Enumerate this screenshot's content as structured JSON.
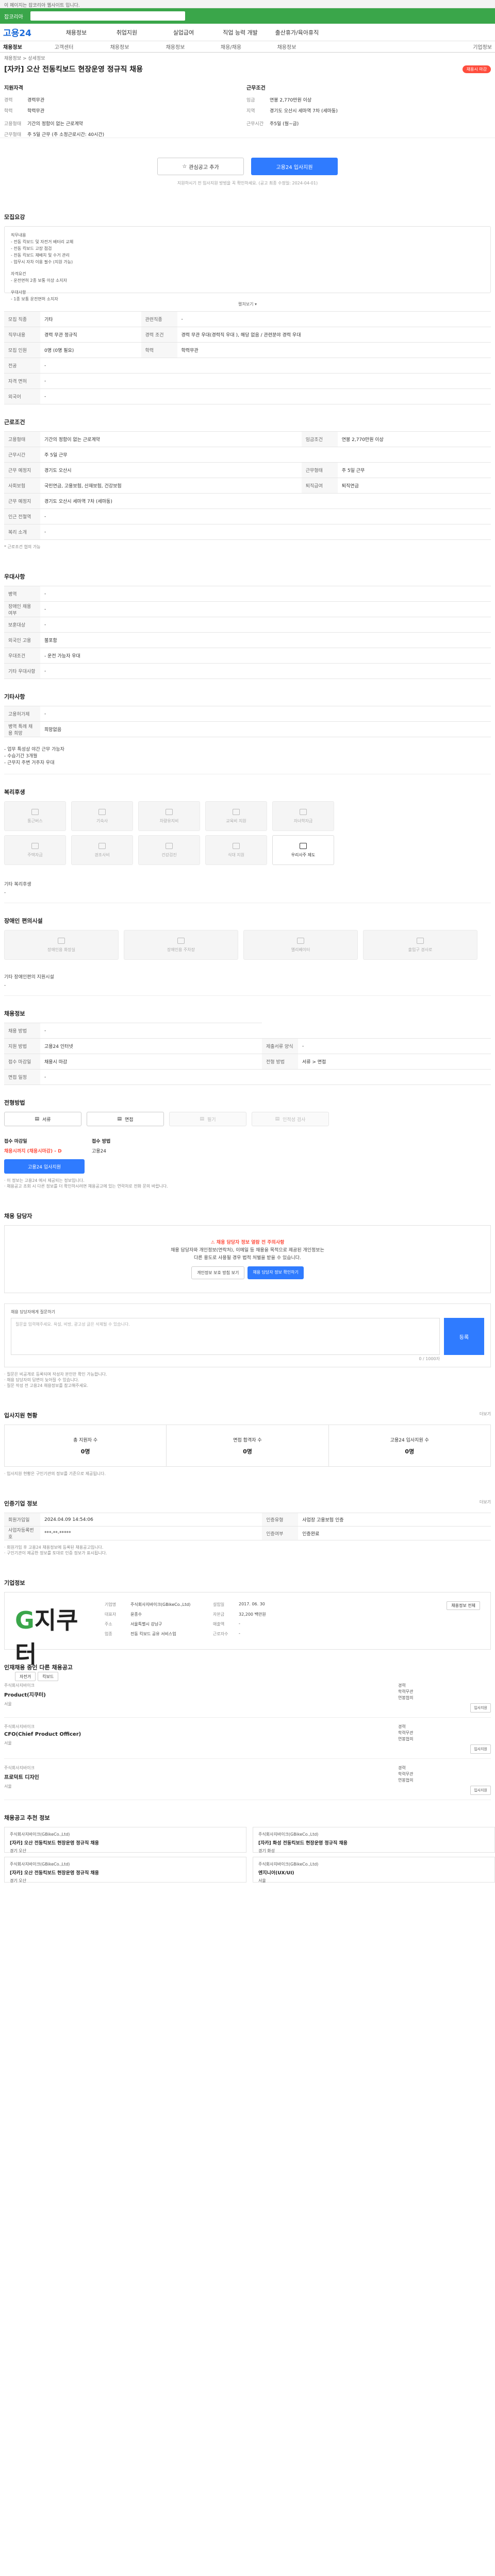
{
  "topnote": "이 페이지는 잡코리아 웹사이트 입니다.",
  "global_bar": {
    "title": "잡코리아"
  },
  "gnb": {
    "logo": "고용24",
    "menu": [
      "채용정보",
      "취업지원",
      "실업급여",
      "직업 능력 개발",
      "출산휴가/육아휴직"
    ]
  },
  "tabs": [
    "채용정보",
    "고객센터",
    "채용정보",
    "채용정보",
    "채용/채용",
    "채용정보",
    "기업정보"
  ],
  "breadcrumb": "채용정보 > 상세정보",
  "job": {
    "title": "[자카] 오산 전동킥보드 현장운영 정규직 채용",
    "badge": "채용시 마감",
    "left_head": "지원자격",
    "left": [
      {
        "k": "경력",
        "v": "경력무관"
      },
      {
        "k": "학력",
        "v": "학력무관"
      }
    ],
    "right_head": "근무조건",
    "right": [
      {
        "k": "임금",
        "v": "연봉 2,770만원 이상"
      },
      {
        "k": "지역",
        "v": "경기도 오산시 세마역 7차 (세마동)"
      }
    ],
    "extra": [
      {
        "k": "고용형태",
        "v": "기간의 정함이 없는 근로계약"
      },
      {
        "k": "근무형태",
        "v": "주 5일 근무 (주 소정근로시간: 40시간)"
      }
    ],
    "extra2": {
      "k": "근무시간",
      "v": "주5일 (월~금)"
    }
  },
  "buttons": {
    "interest": "관심공고 추가",
    "apply": "고용24 입사지원"
  },
  "apply_note": "지원하시기 전 입사지원 방법을 꼭 확인하세요. (공고 최종 수정일: 2024-04-01)",
  "sections": {
    "detail": "모집요강",
    "condition": "근로조건",
    "prefer": "우대사항",
    "other": "기타사항",
    "benefit": "복리후생",
    "facility": "장애인 편의시설",
    "info": "채용정보",
    "method": "전형방법",
    "qna": "채용 담당자",
    "status": "입사지원 현황",
    "company": "인증기업 정보",
    "company_info": "기업정보",
    "other_jobs": "인재채용 중인 다른 채용공고",
    "recommend": "채용공고 추천 정보"
  },
  "detail_text": [
    "직무내용",
    "- 전동 킥보드 및 자전거 배터리 교체",
    "- 전동 킥보드 고장 점검",
    "- 전동 킥보드 재배치 및 수거 관리",
    "- 업무시 자차 이용 필수 (지원 가능)",
    "",
    "자격요건",
    "- 운전면허 2종 보통 이상 소지자",
    "",
    "우대사항",
    "- 1종 보통 운전면허 소지자"
  ],
  "more": "펼쳐보기 ▾",
  "grid1": [
    {
      "k": "모집 직종",
      "v": "기타",
      "k2": "관련직종",
      "v2": "-"
    },
    {
      "k": "직무내용",
      "v": "경력 무관 정규직",
      "k2": "경력 조건",
      "v2": "경력 무관 우대(경력직 우대 ), 해당 없음 / 관련분야 경력 우대"
    },
    {
      "k": "모집 인원",
      "v": "0명 (0명 필요)",
      "k2": "학력",
      "v2": "학력무관"
    },
    {
      "k": "전공",
      "v": "-",
      "k2": "",
      "v2": ""
    },
    {
      "k": "자격 면허",
      "v": "-",
      "k2": "",
      "v2": ""
    },
    {
      "k": "외국어",
      "v": "-",
      "k2": "",
      "v2": ""
    }
  ],
  "grid2": [
    {
      "k": "고용형태",
      "v": "기간의 정함이 없는 근로계약",
      "k2": "임금조건",
      "v2": "연봉 2,770만원 이상"
    },
    {
      "k": "근무시간",
      "v": "주 5일 근무",
      "k2": "",
      "v2": ""
    },
    {
      "k": "근무 예정지",
      "v": "경기도 오산시",
      "k2": "근무형태",
      "v2": "주 5일 근무"
    },
    {
      "k": "사회보험",
      "v": "국민연금, 고용보험, 산재보험, 건강보험",
      "k2": "퇴직급여",
      "v2": "퇴직연금"
    },
    {
      "k": "근무 예정지",
      "v": "경기도 오산시 세마역 7차 (세마동)",
      "k2": "",
      "v2": ""
    },
    {
      "k": "인근 전철역",
      "v": "-",
      "k2": "",
      "v2": ""
    },
    {
      "k": "복리 소개",
      "v": "-",
      "k2": "",
      "v2": ""
    }
  ],
  "grid2_note": "* 근로조건 협의 가능",
  "grid3": [
    {
      "k": "병역",
      "v": "-"
    },
    {
      "k": "장애인 채용 여부",
      "v": "-"
    },
    {
      "k": "보훈대상",
      "v": "-"
    },
    {
      "k": "외국인 고용",
      "v": "불포함"
    },
    {
      "k": "우대조건",
      "v": "- 운전 가능자 우대"
    },
    {
      "k": "기타 우대사항",
      "v": "-"
    }
  ],
  "grid4": [
    {
      "k": "고용허가제",
      "v": "-"
    },
    {
      "k": "병역 특례 채용 희망",
      "v": "희망없음"
    }
  ],
  "other_list": [
    "- 업무 특성상 야간 근무 가능자",
    "- 수습기간 3개월",
    "- 근무지 주변 거주자 우대"
  ],
  "benefits": [
    {
      "label": "통근버스",
      "on": false
    },
    {
      "label": "기숙사",
      "on": false
    },
    {
      "label": "차량유지비",
      "on": false
    },
    {
      "label": "교육비 지원",
      "on": false
    },
    {
      "label": "자녀학자금",
      "on": false
    },
    {
      "label": "주택자금",
      "on": false
    },
    {
      "label": "경조사비",
      "on": false
    },
    {
      "label": "건강검진",
      "on": false
    },
    {
      "label": "식대 지원",
      "on": false
    },
    {
      "label": "우리사주 제도",
      "on": true
    }
  ],
  "benefit_other_label": "기타 복리후생",
  "benefit_other_value": "-",
  "facilities": [
    {
      "label": "장애인용 화장실"
    },
    {
      "label": "장애인용 주차장"
    },
    {
      "label": "엘리베이터"
    },
    {
      "label": "출입구 경사로"
    }
  ],
  "facility_other_label": "기타 장애인편의 지원시설",
  "facility_other_value": "-",
  "grid5": [
    {
      "k": "채용 방법",
      "v": "-"
    },
    {
      "k": "지원 방법",
      "v": "고용24 인터넷",
      "k2": "제출서류 양식",
      "v2": "-"
    },
    {
      "k": "접수 마감일",
      "v": "채용시 마감",
      "k2": "전형 방법",
      "v2": "서류 > 면접"
    },
    {
      "k": "면접 일정",
      "v": "-",
      "k2": "",
      "v2": ""
    }
  ],
  "methods": [
    {
      "label": "서류",
      "on": true
    },
    {
      "label": "면접",
      "on": true
    },
    {
      "label": "필기",
      "on": false
    },
    {
      "label": "인적성 검사",
      "on": false
    }
  ],
  "deadline": {
    "k1": "접수 마감일",
    "v1": "채용시까지 (채용시마감) - D",
    "k2": "접수 방법",
    "v2": "고용24"
  },
  "deadline_apply": "고용24 입사지원",
  "deadline_note": [
    "· 이 정보는 고용24 에서 제공되는 정보입니다.",
    "· 채용공고 조회 시 다른 정보를 더 확인하시려면 채용공고에 있는 연락처로 전화 문의 바랍니다."
  ],
  "warn": {
    "l1": "채용 담당자 정보 열람 전 주의사항",
    "l2": "채용 담당자와 개인정보(연락처), 이메일 등 채용을 목적으로 제공된 개인정보는",
    "l3": "다른 용도로 사용될 경우 법적 처벌을 받을 수 있습니다.",
    "b1": "개인정보 보호 방침 보기",
    "b2": "채용 담당자 정보 확인하기"
  },
  "qna": {
    "title": "채용 담당자에게 질문하기",
    "placeholder": "질문을 입력해주세요. 욕설, 비방, 광고성 글은 삭제될 수 있습니다.",
    "count": "0 / 1000자",
    "register": "등록"
  },
  "qna_notes": [
    "· 질문은 비공개로 등록되며 작성자 본인만 확인 가능합니다.",
    "· 채용 담당자의 답변이 늦어질 수 있습니다.",
    "· 질문 작성 전 고용24 채용정보를 참고해주세요."
  ],
  "status": {
    "more": "더보기",
    "items": [
      {
        "k": "총 지원자 수",
        "v": "0명"
      },
      {
        "k": "면접 합격자 수",
        "v": "0명"
      },
      {
        "k": "고용24 입사지원 수",
        "v": "0명"
      }
    ],
    "note": "· 입사지원 현황은 구인기관의 정보를 기준으로 제공됩니다."
  },
  "cert": {
    "more": "더보기",
    "rows": [
      {
        "k": "회원가입일",
        "v": "2024.04.09 14:54:06",
        "k2": "인증유형",
        "v2": "사업장 고용보험 인증"
      },
      {
        "k": "사업자등록번호",
        "v": "***-**-*****",
        "k2": "인증여부",
        "v2": "인증완료"
      }
    ],
    "notes": [
      "· 회원가입 후 고용24 채용정보에 등록된 채용공고입니다.",
      "· 구인기관이 제공한 정보를 토대로 인증 정보가 표시됩니다."
    ]
  },
  "company": {
    "logo_g": "G",
    "logo_rest": "지쿠터",
    "tags": [
      "자전거",
      "킥보드"
    ],
    "rows": [
      {
        "k": "기업명",
        "v": "주식회사지바이크(GBikeCo.,Ltd)",
        "k2": "설립일",
        "v2": "2017. 06. 30"
      },
      {
        "k": "대표자",
        "v": "윤종수",
        "k2": "자본금",
        "v2": "32,200 백만원"
      },
      {
        "k": "주소",
        "v": "서울특별시 강남구",
        "k2": "매출액",
        "v2": "-"
      },
      {
        "k": "업종",
        "v": "전동 킥보드 공유 서비스업",
        "k2": "근로자수",
        "v2": "-"
      }
    ],
    "btn": "채용정보 전체"
  },
  "other_jobs": [
    {
      "co": "주식회사지바이크",
      "title": "Product(지쿠터)",
      "loc": "서울",
      "right": [
        "경력",
        "학력무관",
        "연봉협의"
      ],
      "btn": "입사지원"
    },
    {
      "co": "주식회사지바이크",
      "title": "CFO(Chief Product Officer)",
      "loc": "서울",
      "right": [
        "경력",
        "학력무관",
        "연봉협의"
      ],
      "btn": "입사지원"
    },
    {
      "co": "주식회사지바이크",
      "title": "프로덕트 디자인",
      "loc": "서울",
      "right": [
        "경력",
        "학력무관",
        "연봉협의"
      ],
      "btn": "입사지원"
    }
  ],
  "recommend": [
    {
      "co": "주식회사지바이크(GBikeCo.,Ltd)",
      "title": "[자카] 오산 전동킥보드 현장운영 정규직 채용",
      "sub": "경기 오산"
    },
    {
      "co": "주식회사지바이크(GBikeCo.,Ltd)",
      "title": "[자카] 화성 전동킥보드 현장운영 정규직 채용",
      "sub": "경기 화성"
    },
    {
      "co": "주식회사지바이크(GBikeCo.,Ltd)",
      "title": "[자카] 오산 전동킥보드 현장운영 정규직 채용",
      "sub": "경기 오산"
    },
    {
      "co": "주식회사지바이크(GBikeCo.,Ltd)",
      "title": "엔지니어(UX/UI)",
      "sub": "서울"
    }
  ]
}
